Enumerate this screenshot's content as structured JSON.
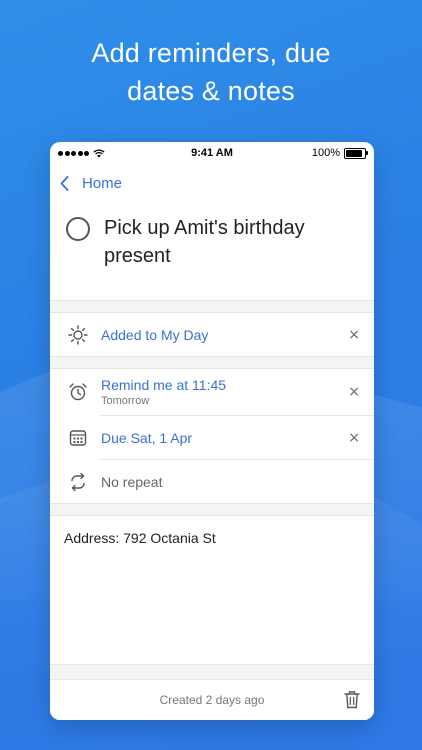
{
  "headline": {
    "line1": "Add reminders, due",
    "line2": "dates & notes"
  },
  "status_bar": {
    "time": "9:41 AM",
    "battery_text": "100%",
    "battery_level": 1.0
  },
  "nav": {
    "back_label": "Home"
  },
  "task": {
    "title": "Pick up Amit's birthday present",
    "completed": false
  },
  "my_day": {
    "label": "Added to My Day",
    "icon": "sun-icon",
    "remove": "×"
  },
  "reminder": {
    "label": "Remind me at 11:45",
    "sub": "Tomorrow",
    "icon": "alarm-clock-icon",
    "remove": "×"
  },
  "due": {
    "label": "Due Sat, 1 Apr",
    "icon": "calendar-icon",
    "remove": "×"
  },
  "repeat": {
    "label": "No repeat",
    "icon": "repeat-icon"
  },
  "note": {
    "text": "Address: 792 Octania St"
  },
  "footer": {
    "created": "Created 2 days ago",
    "icon": "trash-icon"
  },
  "colors": {
    "accent": "#3c6fd6",
    "background": "#2f8ee8"
  }
}
